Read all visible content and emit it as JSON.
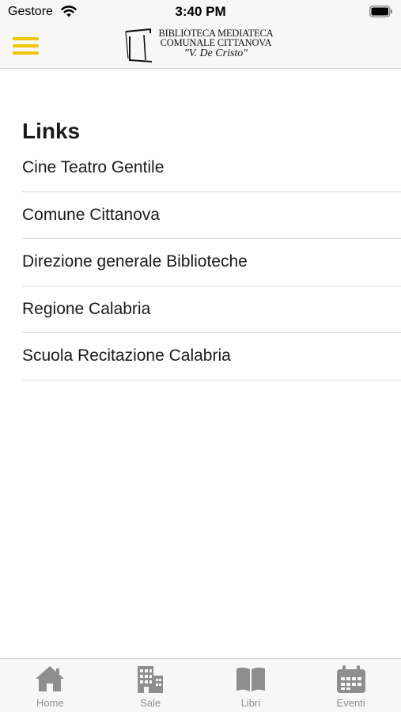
{
  "status_bar": {
    "carrier": "Gestore",
    "time": "3:40 PM"
  },
  "nav": {
    "logo_line1": "BIBLIOTECA MEDIATECA",
    "logo_line2": "COMUNALE CITTANOVA",
    "logo_line3": "\"V. De Cristo\""
  },
  "links": {
    "title": "Links",
    "items": [
      {
        "label": "Cine Teatro Gentile"
      },
      {
        "label": "Comune Cittanova"
      },
      {
        "label": "Direzione generale Biblioteche"
      },
      {
        "label": "Regione Calabria"
      },
      {
        "label": "Scuola Recitazione Calabria"
      }
    ]
  },
  "tabs": [
    {
      "label": "Home",
      "icon": "home-icon"
    },
    {
      "label": "Sale",
      "icon": "building-icon"
    },
    {
      "label": "Libri",
      "icon": "book-icon"
    },
    {
      "label": "Eventi",
      "icon": "calendar-icon"
    }
  ],
  "colors": {
    "accent": "#f2c500",
    "tab_inactive": "#8e8e8e"
  }
}
